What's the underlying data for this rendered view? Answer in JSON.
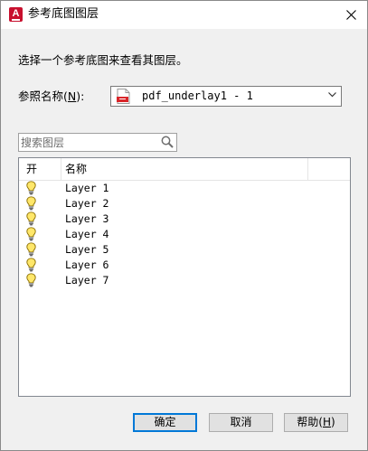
{
  "window": {
    "title": "参考底图图层",
    "app_icon": "autocad-app-icon",
    "close_icon": "close-icon"
  },
  "instruction": "选择一个参考底图来查看其图层。",
  "reference": {
    "label_prefix": "参照名称(",
    "label_key": "N",
    "label_suffix": "):",
    "selected_value": "pdf_underlay1 - 1",
    "file_icon": "pdf-file-icon",
    "dropdown_icon": "chevron-down-icon"
  },
  "search": {
    "placeholder": "搜索图层",
    "icon": "search-icon"
  },
  "layer_list": {
    "columns": [
      "开",
      "名称"
    ],
    "rows": [
      {
        "on": true,
        "name": "Layer 1"
      },
      {
        "on": true,
        "name": "Layer 2"
      },
      {
        "on": true,
        "name": "Layer 3"
      },
      {
        "on": true,
        "name": "Layer 4"
      },
      {
        "on": true,
        "name": "Layer 5"
      },
      {
        "on": true,
        "name": "Layer 6"
      },
      {
        "on": true,
        "name": "Layer 7"
      }
    ],
    "on_icon": "lightbulb-on-icon"
  },
  "buttons": {
    "ok": "确定",
    "cancel": "取消",
    "help_prefix": "帮助(",
    "help_key": "H",
    "help_suffix": ")"
  },
  "colors": {
    "accent": "#0078d7",
    "app_icon_red": "#c8102e",
    "bulb_yellow": "#ffe76a"
  }
}
